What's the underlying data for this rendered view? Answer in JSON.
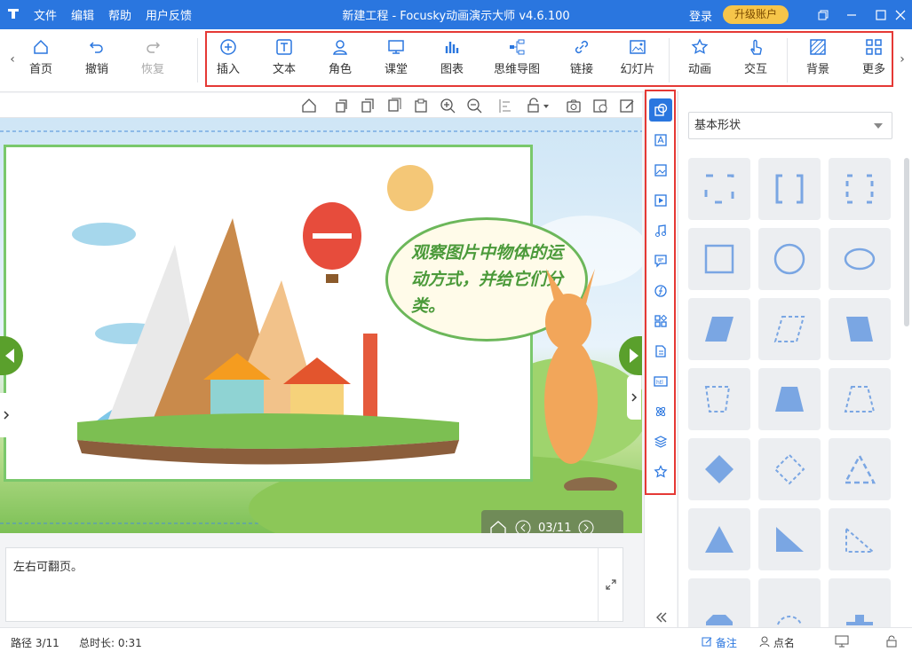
{
  "titlebar": {
    "menu": [
      "文件",
      "编辑",
      "帮助",
      "用户反馈"
    ],
    "title": "新建工程 - Focusky动画演示大师  v4.6.100",
    "login": "登录",
    "upgrade": "升级账户"
  },
  "toolbar": {
    "home": "首页",
    "undo": "撤销",
    "redo": "恢复",
    "insert": "插入",
    "text": "文本",
    "role": "角色",
    "class": "课堂",
    "chart": "图表",
    "mindmap": "思维导图",
    "link": "链接",
    "slides": "幻灯片",
    "animation": "动画",
    "interaction": "交互",
    "background": "背景",
    "more": "更多"
  },
  "slide": {
    "bubble_text": "观察图片中物体的运动方式，并给它们分类。",
    "pager": "03/11"
  },
  "notes": {
    "text": "左右可翻页。"
  },
  "panel": {
    "dropdown_value": "基本形状"
  },
  "statusbar": {
    "path": "路径 3/11",
    "duration": "总时长: 0:31",
    "notes": "备注",
    "rollcall": "点名"
  },
  "colors": {
    "accent": "#2a76df",
    "shape_fill": "#7aa6e3",
    "highlight": "#e53935"
  }
}
